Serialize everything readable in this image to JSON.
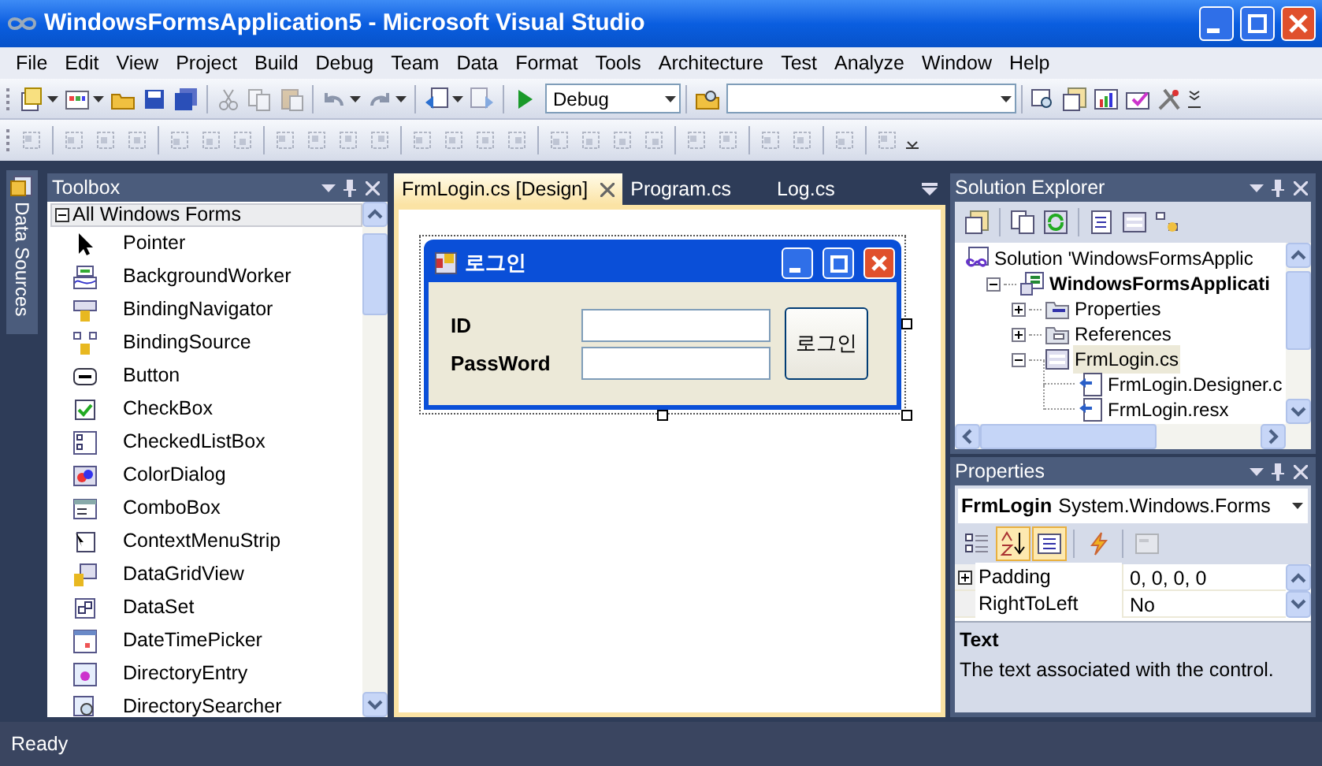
{
  "window": {
    "title": "WindowsFormsApplication5 - Microsoft Visual Studio"
  },
  "menu": [
    "File",
    "Edit",
    "View",
    "Project",
    "Build",
    "Debug",
    "Team",
    "Data",
    "Format",
    "Tools",
    "Architecture",
    "Test",
    "Analyze",
    "Window",
    "Help"
  ],
  "toolbar": {
    "configuration": "Debug"
  },
  "side_tab": {
    "label": "Data Sources"
  },
  "toolbox": {
    "title": "Toolbox",
    "group": {
      "label": "All Windows Forms",
      "expanded": true
    },
    "items": [
      "Pointer",
      "BackgroundWorker",
      "BindingNavigator",
      "BindingSource",
      "Button",
      "CheckBox",
      "CheckedListBox",
      "ColorDialog",
      "ComboBox",
      "ContextMenuStrip",
      "DataGridView",
      "DataSet",
      "DateTimePicker",
      "DirectoryEntry",
      "DirectorySearcher"
    ]
  },
  "editor": {
    "tabs": [
      {
        "label": "FrmLogin.cs [Design]",
        "selected": true
      },
      {
        "label": "Program.cs",
        "selected": false
      },
      {
        "label": "Log.cs",
        "selected": false
      }
    ],
    "form": {
      "title": "로그인",
      "labels": [
        "ID",
        "PassWord"
      ],
      "button": "로그인"
    }
  },
  "solution_explorer": {
    "title": "Solution Explorer",
    "tree": [
      {
        "label": "Solution 'WindowsFormsApplic",
        "kind": "solution",
        "selected": false,
        "children": [
          {
            "label": "WindowsFormsApplicati",
            "kind": "project",
            "expanded": true,
            "selected": false,
            "children": [
              {
                "label": "Properties",
                "kind": "folder",
                "expanded": false,
                "selected": false
              },
              {
                "label": "References",
                "kind": "references",
                "expanded": false,
                "selected": false
              },
              {
                "label": "FrmLogin.cs",
                "kind": "form",
                "expanded": true,
                "selected": true,
                "children": [
                  {
                    "label": "FrmLogin.Designer.c",
                    "selected": false
                  },
                  {
                    "label": "FrmLogin.resx",
                    "selected": false
                  }
                ]
              }
            ]
          }
        ]
      }
    ]
  },
  "properties": {
    "title": "Properties",
    "object": "FrmLogin",
    "type": "System.Windows.Forms",
    "view_buttons": [
      {
        "selected": false
      },
      {
        "selected": true
      },
      {
        "selected": true
      },
      {
        "selected": false
      },
      {
        "selected": false
      }
    ],
    "rows": [
      {
        "name": "Padding",
        "value": "0, 0, 0, 0",
        "kind": "group"
      },
      {
        "name": "RightToLeft",
        "value": "No",
        "kind": "plain"
      }
    ],
    "description": {
      "title": "Text",
      "text": "The text associated with the control."
    }
  },
  "status_bar": {
    "text": "Ready"
  }
}
